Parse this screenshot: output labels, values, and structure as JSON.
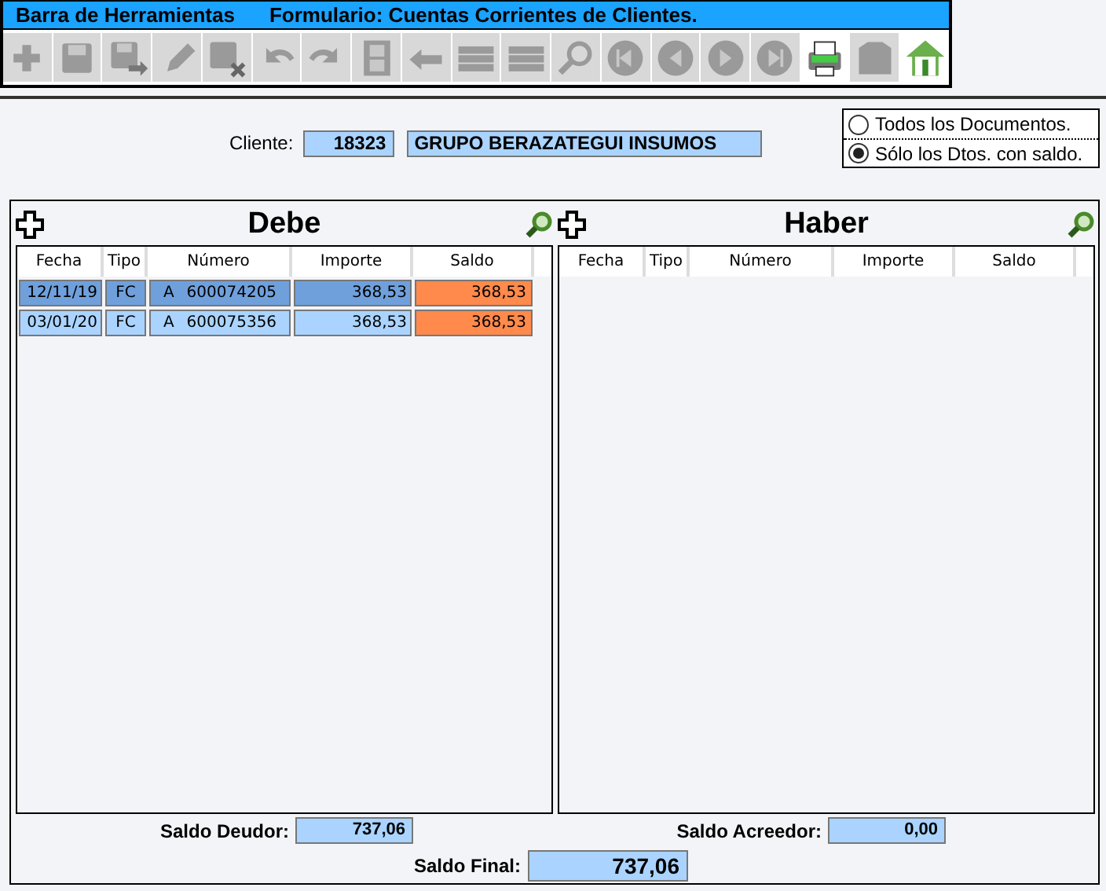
{
  "title_bar": {
    "left": "Barra de Herramientas",
    "right": "Formulario: Cuentas Corrientes de Clientes."
  },
  "toolbar": [
    {
      "kind": "add",
      "disabled": true
    },
    {
      "kind": "save",
      "disabled": true
    },
    {
      "kind": "save-as",
      "disabled": true
    },
    {
      "kind": "edit",
      "disabled": true
    },
    {
      "kind": "delete",
      "disabled": true
    },
    {
      "kind": "undo",
      "disabled": true
    },
    {
      "kind": "redo",
      "disabled": true
    },
    {
      "kind": "film",
      "disabled": true
    },
    {
      "kind": "back",
      "disabled": true
    },
    {
      "kind": "list",
      "disabled": true
    },
    {
      "kind": "list",
      "disabled": true
    },
    {
      "kind": "search",
      "disabled": true
    },
    {
      "kind": "first",
      "disabled": true
    },
    {
      "kind": "prev",
      "disabled": true
    },
    {
      "kind": "next",
      "disabled": true
    },
    {
      "kind": "last",
      "disabled": true
    },
    {
      "kind": "print",
      "disabled": false
    },
    {
      "kind": "box",
      "disabled": true
    },
    {
      "kind": "home",
      "disabled": false
    }
  ],
  "client": {
    "label": "Cliente:",
    "code": "18323",
    "name": "GRUPO BERAZATEGUI INSUMOS"
  },
  "filter": [
    {
      "label": "Todos los Documentos.",
      "selected": false
    },
    {
      "label": "Sólo los Dtos. con saldo.",
      "selected": true
    }
  ],
  "panels": [
    {
      "title": "Debe",
      "columns": [
        "Fecha",
        "Tipo",
        "Número",
        "Importe",
        "Saldo"
      ],
      "rows": [
        {
          "fecha": "12/11/19",
          "tipo": "FC",
          "letra": "A",
          "numero": "600074205",
          "importe": "368,53",
          "saldo": "368,53",
          "selected": true
        },
        {
          "fecha": "03/01/20",
          "tipo": "FC",
          "letra": "A",
          "numero": "600075356",
          "importe": "368,53",
          "saldo": "368,53",
          "selected": false
        }
      ]
    },
    {
      "title": "Haber",
      "columns": [
        "Fecha",
        "Tipo",
        "Número",
        "Importe",
        "Saldo"
      ]
    }
  ],
  "totals": {
    "debit_label": "Saldo Deudor:",
    "debit": "737,06",
    "credit_label": "Saldo Acreedor:",
    "credit": "0,00",
    "final_label": "Saldo Final:",
    "final": "737,06"
  }
}
